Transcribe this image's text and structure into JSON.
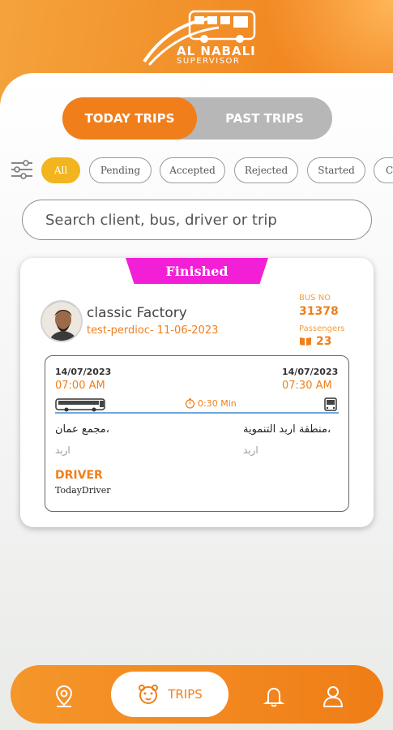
{
  "app": {
    "brand_line1": "AL NABALI",
    "brand_line2": "SUPERVISOR",
    "accent_color": "#f07f1b"
  },
  "tabs": {
    "active": "TODAY TRIPS",
    "inactive": "PAST TRIPS"
  },
  "filters": {
    "icon": "filter-sliders-icon",
    "chips": [
      "All",
      "Pending",
      "Accepted",
      "Rejected",
      "Started",
      "C"
    ],
    "selected": "All"
  },
  "search": {
    "placeholder": "Search client, bus, driver or trip"
  },
  "trip": {
    "status": "Finished",
    "status_color": "#f21fd6",
    "client_name": "classic Factory",
    "trip_name": "test-perdioc- 11-06-2023",
    "bus_no_label": "BUS NO",
    "bus_no": "31378",
    "passengers_label": "Passengers",
    "passengers": "23",
    "start_date": "14/07/2023",
    "start_time": "07:00 AM",
    "end_date": "14/07/2023",
    "end_time": "07:30 AM",
    "duration": "0:30 Min",
    "from_place": "مجمع عمان،",
    "from_city": "اربد",
    "to_place": "منطقة اربد التنموية،",
    "to_city": "اربد",
    "driver_label": "DRIVER",
    "driver_name": "TodayDriver"
  },
  "nav": {
    "items": [
      {
        "icon": "location-pin-icon"
      },
      {
        "icon": "tiger-icon",
        "label": "TRIPS"
      },
      {
        "icon": "bell-icon"
      },
      {
        "icon": "user-icon"
      }
    ]
  }
}
